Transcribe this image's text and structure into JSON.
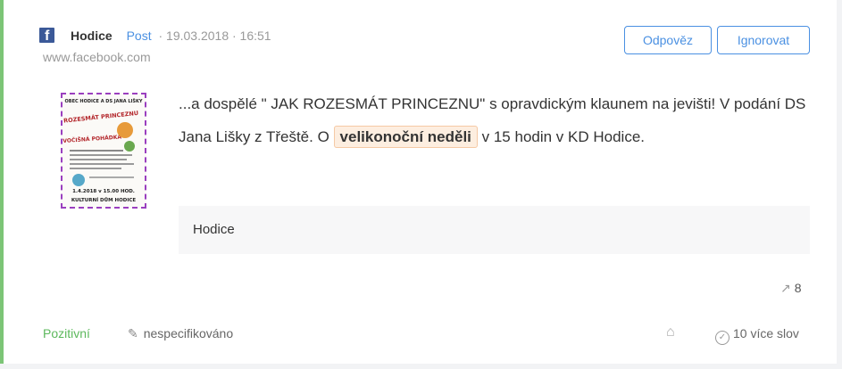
{
  "post": {
    "source_name": "Hodice",
    "type": "Post",
    "meta": "· 19.03.2018 · 16:51",
    "source_url": "www.facebook.com",
    "content_before": "...a dospělé \" JAK ROZESMÁT PRINCEZNU\" s opravdickým klaunem na jevišti! V podání DS Jana Lišky z Třeště. O ",
    "content_highlight": "velikonoční neděli",
    "content_after": " v 15 hodin v KD Hodice.",
    "group": "Hodice",
    "shares": "8"
  },
  "actions": {
    "reply_label": "Odpověz",
    "ignore_label": "Ignorovat"
  },
  "thumbnail": {
    "line1": "OBEC HODICE A DS JANA LIŠKY",
    "line2": "JAK ROZESMÁT PRINCEZNU",
    "line3": "ŽIVOČIŠNÁ POHÁDKA",
    "date": "1.4.2018 v 15.00 HOD.",
    "venue": "KULTURNÍ DŮM HODICE"
  },
  "footer": {
    "sentiment": "Pozitivní",
    "author": "nespecifikováno",
    "more_words": "10 více slov"
  },
  "colors": {
    "accent": "#4a90e2",
    "positive": "#5cb85c",
    "left_border": "#7cc576",
    "facebook": "#3b5998",
    "highlight_bg": "#fdeee0"
  },
  "icons": [
    "facebook-icon",
    "share-icon",
    "pen-icon",
    "tag-icon",
    "check-circle-icon"
  ]
}
